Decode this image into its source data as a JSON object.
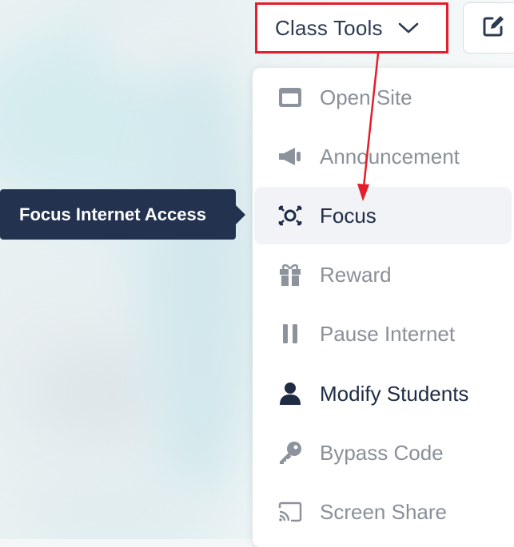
{
  "toolbar": {
    "class_tools_label": "Class Tools",
    "chevron_icon": "chevron-down-icon",
    "edit_icon": "edit-icon"
  },
  "menu": {
    "items": [
      {
        "label": "Open Site",
        "icon": "browser-window-icon",
        "state": "disabled"
      },
      {
        "label": "Announcement",
        "icon": "megaphone-icon",
        "state": "disabled"
      },
      {
        "label": "Focus",
        "icon": "focus-icon",
        "state": "active"
      },
      {
        "label": "Reward",
        "icon": "gift-icon",
        "state": "disabled"
      },
      {
        "label": "Pause Internet",
        "icon": "pause-icon",
        "state": "disabled"
      },
      {
        "label": "Modify Students",
        "icon": "user-icon",
        "state": "enabled"
      },
      {
        "label": "Bypass Code",
        "icon": "key-icon",
        "state": "disabled"
      },
      {
        "label": "Screen Share",
        "icon": "cast-icon",
        "state": "disabled"
      }
    ]
  },
  "tooltip": {
    "text": "Focus Internet Access"
  },
  "colors": {
    "highlight_border": "#e31e2a",
    "annotation_arrow": "#e31e2a",
    "tooltip_bg": "#22324f",
    "active_text": "#1f2c44",
    "disabled_text": "#8a9099"
  }
}
